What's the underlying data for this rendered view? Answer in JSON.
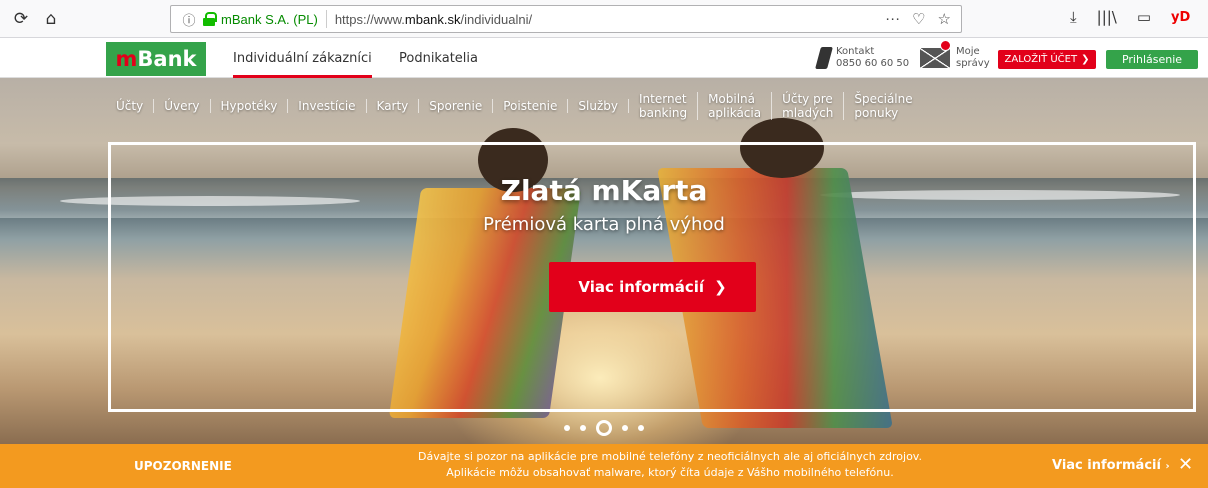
{
  "browser": {
    "back_icon": "reload-icon",
    "home_icon": "home-icon",
    "org": "mBank S.A. (PL)",
    "url_prefix": "https://www.",
    "url_domain": "mbank.sk",
    "url_path": "/individualni/",
    "yd": "yD"
  },
  "header": {
    "logo_m": "m",
    "logo_text": "Bank",
    "tabs": [
      {
        "label": "Individuální zákazníci"
      },
      {
        "label": "Podnikatelia"
      }
    ],
    "contact_label": "Kontakt",
    "contact_phone": "0850 60 60 50",
    "mail_label1": "Moje",
    "mail_label2": "správy",
    "open_account": "ZALOŽIŤ ÚČET",
    "login": "Prihlásenie"
  },
  "nav": [
    {
      "label": "Účty"
    },
    {
      "label": "Úvery"
    },
    {
      "label": "Hypotéky"
    },
    {
      "label": "Investície"
    },
    {
      "label": "Karty"
    },
    {
      "label": "Sporenie"
    },
    {
      "label": "Poistenie"
    },
    {
      "label": "Služby"
    },
    {
      "label": "Internet\nbanking"
    },
    {
      "label": "Mobilná\naplikácia"
    },
    {
      "label": "Účty pre\nmladých"
    },
    {
      "label": "Špeciálne\nponuky"
    }
  ],
  "hero": {
    "title": "Zlatá mKarta",
    "subtitle": "Prémiová karta plná výhod",
    "cta": "Viac informácií",
    "slides": 5,
    "active_slide": 3
  },
  "warning": {
    "label": "UPOZORNENIE",
    "line1": "Dávajte si pozor na aplikácie pre mobilné telefóny z neoficiálnych ale aj oficiálnych zdrojov.",
    "line2": "Aplikácie môžu obsahovať malware, ktorý číta údaje z Vášho mobilného telefónu.",
    "more": "Viac informácií",
    "close": "✕"
  }
}
